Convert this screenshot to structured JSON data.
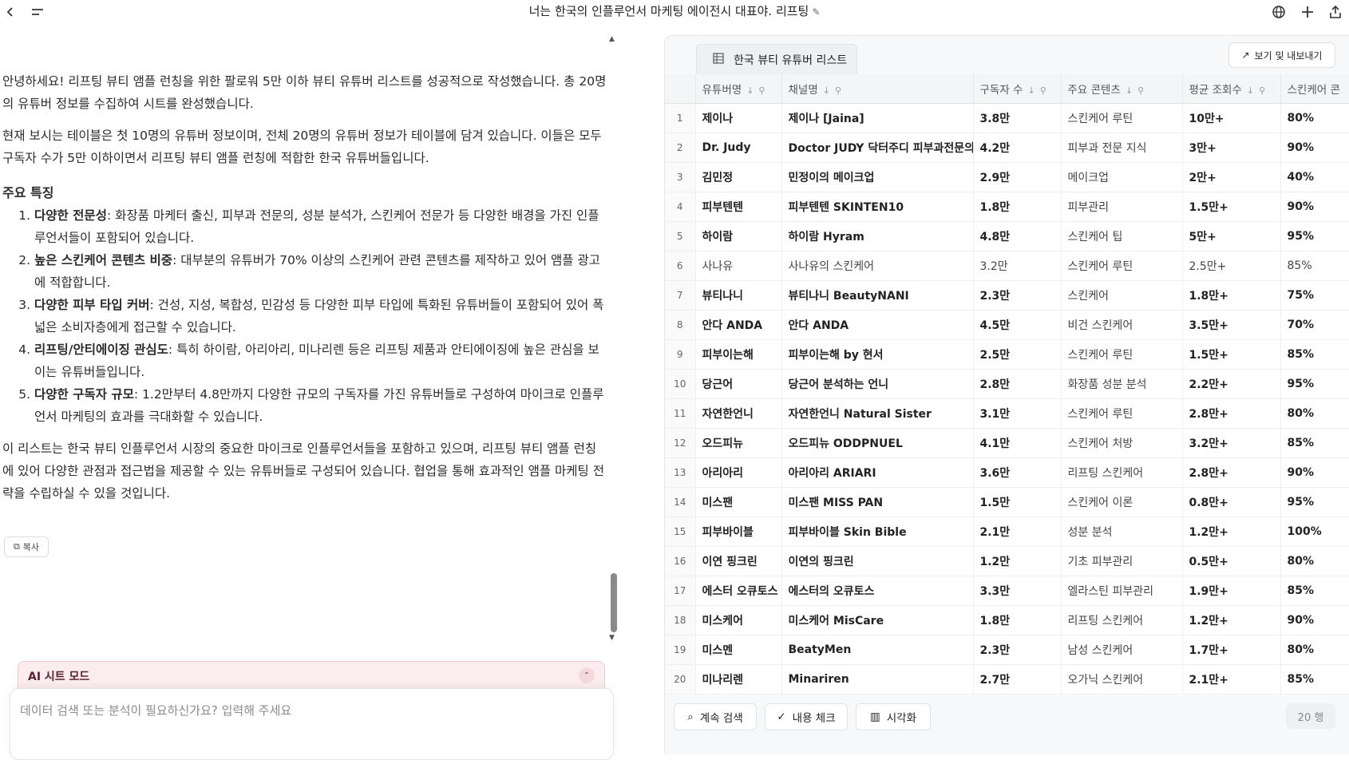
{
  "header": {
    "title": "너는 한국의 인플루언서 마케팅 에이전시 대표야. 리프팅",
    "back_icon": "chevron-left-icon",
    "menu_icon": "menu-icon",
    "edit_icon": "pencil-icon"
  },
  "chat": {
    "intro1": "안녕하세요! 리프팅 뷰티 앰플 런칭을 위한 팔로워 5만 이하 뷰티 유튜버 리스트를 성공적으로 작성했습니다. 총 20명의 유튜버 정보를 수집하여 시트를 완성했습니다.",
    "intro2": "현재 보시는 테이블은 첫 10명의 유튜버 정보이며, 전체 20명의 유튜버 정보가 테이블에 담겨 있습니다. 이들은 모두 구독자 수가 5만 이하이면서 리프팅 뷰티 앰플 런칭에 적합한 한국 유튜버들입니다.",
    "features_title": "주요 특징",
    "features": [
      {
        "bold": "다양한 전문성",
        "text": ": 화장품 마케터 출신, 피부과 전문의, 성분 분석가, 스킨케어 전문가 등 다양한 배경을 가진 인플루언서들이 포함되어 있습니다."
      },
      {
        "bold": "높은 스킨케어 콘텐츠 비중",
        "text": ": 대부분의 유튜버가 70% 이상의 스킨케어 관련 콘텐츠를 제작하고 있어 앰플 광고에 적합합니다."
      },
      {
        "bold": "다양한 피부 타입 커버",
        "text": ": 건성, 지성, 복합성, 민감성 등 다양한 피부 타입에 특화된 유튜버들이 포함되어 있어 폭넓은 소비자층에게 접근할 수 있습니다."
      },
      {
        "bold": "리프팅/안티에이징 관심도",
        "text": ": 특히 하이람, 아리아리, 미나리렌 등은 리프팅 제품과 안티에이징에 높은 관심을 보이는 유튜버들입니다."
      },
      {
        "bold": "다양한 구독자 규모",
        "text": ": 1.2만부터 4.8만까지 다양한 규모의 구독자를 가진 유튜버들로 구성하여 마이크로 인플루언서 마케팅의 효과를 극대화할 수 있습니다."
      }
    ],
    "outro": "이 리스트는 한국 뷰티 인플루언서 시장의 중요한 마이크로 인플루언서들을 포함하고 있으며, 리프팅 뷰티 앰플 런칭에 있어 다양한 관점과 접근법을 제공할 수 있는 유튜버들로 구성되어 있습니다. 협업을 통해 효과적인 앰플 마케팅 전략을 수립하실 수 있을 것입니다.",
    "copy_label": "복사"
  },
  "ai_mode": {
    "label": "AI 시트 모드",
    "placeholder": "데이터 검색 또는 분석이 필요하신가요? 입력해 주세요"
  },
  "sheet": {
    "tab_label": "한국 뷰티 유튜버 리스트",
    "export_label": "보기 및 내보내기",
    "columns": [
      "유튜버명",
      "채널명",
      "구독자 수",
      "주요 콘텐츠",
      "평균 조회수",
      "스킨케어 콘"
    ],
    "rows": [
      [
        "1",
        "제이나",
        "제이나 [Jaina]",
        "3.8만",
        "스킨케어 루틴",
        "10만+",
        "80%"
      ],
      [
        "2",
        "Dr. Judy",
        "Doctor JUDY 닥터주디 피부과전문의",
        "4.2만",
        "피부과 전문 지식",
        "3만+",
        "90%"
      ],
      [
        "3",
        "김민정",
        "민정이의 메이크업",
        "2.9만",
        "메이크업",
        "2만+",
        "40%"
      ],
      [
        "4",
        "피부텐텐",
        "피부텐텐 SKINTEN10",
        "1.8만",
        "피부관리",
        "1.5만+",
        "90%"
      ],
      [
        "5",
        "하이람",
        "하이람 Hyram",
        "4.8만",
        "스킨케어 팁",
        "5만+",
        "95%"
      ],
      [
        "6",
        "사나유",
        "사나유의 스킨케어",
        "3.2만",
        "스킨케어 루틴",
        "2.5만+",
        "85%"
      ],
      [
        "7",
        "뷰티나니",
        "뷰티나니 BeautyNANI",
        "2.3만",
        "스킨케어",
        "1.8만+",
        "75%"
      ],
      [
        "8",
        "안다 ANDA",
        "안다 ANDA",
        "4.5만",
        "비건 스킨케어",
        "3.5만+",
        "70%"
      ],
      [
        "9",
        "피부이는해",
        "피부이는해 by 현서",
        "2.5만",
        "스킨케어 루틴",
        "1.5만+",
        "85%"
      ],
      [
        "10",
        "당근어",
        "당근어 분석하는 언니",
        "2.8만",
        "화장품 성분 분석",
        "2.2만+",
        "95%"
      ],
      [
        "11",
        "자연한언니",
        "자연한언니 Natural Sister",
        "3.1만",
        "스킨케어 루틴",
        "2.8만+",
        "80%"
      ],
      [
        "12",
        "오드피뉴",
        "오드피뉴 ODDPNUEL",
        "4.1만",
        "스킨케어 처방",
        "3.2만+",
        "85%"
      ],
      [
        "13",
        "아리아리",
        "아리아리 ARIARI",
        "3.6만",
        "리프팅 스킨케어",
        "2.8만+",
        "90%"
      ],
      [
        "14",
        "미스팬",
        "미스팬 MISS PAN",
        "1.5만",
        "스킨케어 이론",
        "0.8만+",
        "95%"
      ],
      [
        "15",
        "피부바이블",
        "피부바이블 Skin Bible",
        "2.1만",
        "성분 분석",
        "1.2만+",
        "100%"
      ],
      [
        "16",
        "이연 핑크린",
        "이연의 핑크린",
        "1.2만",
        "기초 피부관리",
        "0.5만+",
        "80%"
      ],
      [
        "17",
        "에스터 오큐토스",
        "에스터의 오큐토스",
        "3.3만",
        "엘라스틴 피부관리",
        "1.9만+",
        "85%"
      ],
      [
        "18",
        "미스케어",
        "미스케어 MisCare",
        "1.8만",
        "리프팅 스킨케어",
        "1.2만+",
        "90%"
      ],
      [
        "19",
        "미스멘",
        "BeatyMen",
        "2.3만",
        "남성 스킨케어",
        "1.7만+",
        "80%"
      ],
      [
        "20",
        "미나리렌",
        "Minariren",
        "2.7만",
        "오가닉 스킨케어",
        "2.1만+",
        "85%"
      ]
    ],
    "actions": [
      "계속 검색",
      "내용 체크",
      "시각화"
    ],
    "row_count": "20 행"
  }
}
